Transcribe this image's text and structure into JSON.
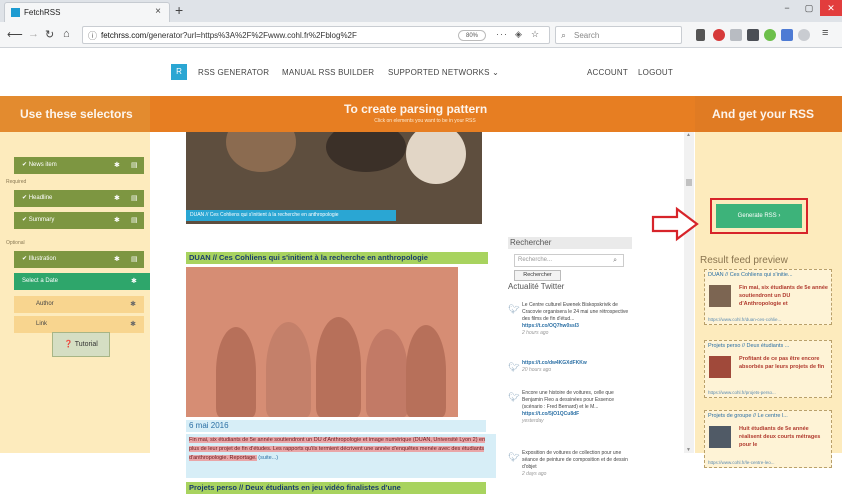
{
  "browser": {
    "tab_title": "FetchRSS",
    "tab_close": "×",
    "new_tab": "+",
    "url_prefix": "fetchrss.com",
    "url_rest": "/generator?url=https%3A%2F%2Fwww.cohl.fr%2Fblog%2F",
    "zoom": "80%",
    "page_actions": "···",
    "search_placeholder": "Search",
    "window_min": "−",
    "window_max": "▢",
    "window_close": "✕"
  },
  "site_nav": {
    "logo": "R",
    "items": [
      "RSS GENERATOR",
      "MANUAL RSS BUILDER",
      "SUPPORTED NETWORKS ⌄",
      "ACCOUNT",
      "LOGOUT"
    ]
  },
  "headers": {
    "left": "Use these selectors",
    "center": "To create parsing pattern",
    "center_sub": "Click on elements you want to be in your RSS",
    "right": "And get your RSS"
  },
  "selectors": {
    "news_item": "News item",
    "required_label": "Required",
    "headline": "Headline",
    "summary": "Summary",
    "optional_label": "Optional",
    "illustration": "Illustration",
    "date": "Select a Date",
    "author": "Author",
    "link": "Link",
    "tutorial": "Tutorial"
  },
  "content": {
    "hero_caption": "DUAN // Ces Cohliens qui s'initient à la recherche en anthropologie",
    "post1_title": "DUAN // Ces Cohliens qui s'initient à la recherche en anthropologie",
    "post1_date": "6 mai 2016",
    "post1_text": "Fin mai, six étudiants de 5e année soutiendront un DU d'Anthropologie et image numérique (DUAN, Université Lyon 2) en plus de leur projet de fin d'études. Les rapports qu'ils termient décrivent une année d'enquêtes menée avec des étudiants d'anthropologie. Reportage.",
    "post1_more": "(suite...)",
    "post2_title": "Projets perso // Deux étudiants en jeu vidéo finalistes d'une"
  },
  "sidebar": {
    "search_title": "Rechercher",
    "search_placeholder": "Recherche...",
    "search_button": "Rechercher",
    "twitter_title": "Actualité Twitter",
    "tweets": [
      {
        "text": "Le Centre culturel Ewenek Biskopskrivik de Cracovie organisera le 24 mai une rétrospective des films de fin d'étud...",
        "link": "https://t.co/OQ7hw0ssI3",
        "time": "2 hours ago"
      },
      {
        "text": "",
        "link": "https://t.co/dw4KGXdFKKw",
        "time": "20 hours ago"
      },
      {
        "text": "Encore une histoire de voitures, celle que Benjamin Fleo a dessinées pour Essence (scénario : Fred Bernard) et le M...",
        "link": "https://t.co/5jO1QCu8dF",
        "time": "yesterday"
      },
      {
        "text": "Exposition de voitures de collection pour une séance de peinture de composition et de dessin d'objet",
        "link": "",
        "time": "2 days ago"
      }
    ]
  },
  "result": {
    "generate_button": "Generate RSS ›",
    "preview_title": "Result feed preview",
    "cards": [
      {
        "title": "DUAN // Ces Cohliens qui s'initie...",
        "desc": "Fin mai, six étudiants de 5e année soutiendront un DU d'Anthropologie et",
        "url": "https://www.cohl.fr/duan-ces-cohlie..."
      },
      {
        "title": "Projets perso // Deux étudiants ...",
        "desc": "Profitant de ce pas être encore absorbés par leurs projets de fin",
        "url": "https://www.cohl.fr/projets-perso..."
      },
      {
        "title": "Projets de groupe // Le centre l...",
        "desc": "Huit étudiants de 5e année réalisent deux courts métrages pour le",
        "url": "https://www.cohl.fr/le-centre-leo..."
      }
    ]
  },
  "colors": {
    "orange_header": "#e77e22",
    "panel_bg": "#fdebbd",
    "selector_green": "#7d9641",
    "active_green": "#2ea66b",
    "link_blue": "#2a6fa4",
    "highlight_red": "#d7242a"
  }
}
